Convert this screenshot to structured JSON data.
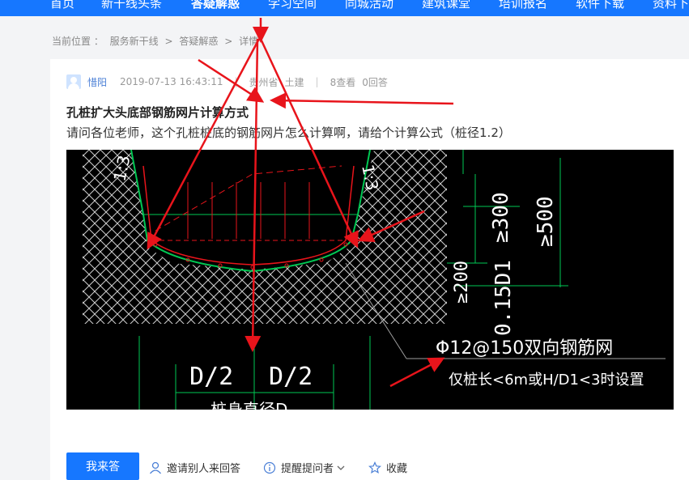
{
  "nav": {
    "items": [
      {
        "label": "首页"
      },
      {
        "label": "新干线头条"
      },
      {
        "label": "答疑解惑"
      },
      {
        "label": "学习空间"
      },
      {
        "label": "同城活动"
      },
      {
        "label": "建筑课堂"
      },
      {
        "label": "培训报名"
      },
      {
        "label": "软件下载"
      },
      {
        "label": "资料下"
      }
    ],
    "active": "答疑解惑"
  },
  "breadcrumb": {
    "prefix": "当前位置 ：",
    "items": [
      "服务新干线",
      "答疑解惑",
      "详情"
    ],
    "separator": ">"
  },
  "question": {
    "author": "惜阳",
    "datetime": "2019-07-13 16:43:11",
    "region": "贵州省",
    "category": "土建",
    "views": "8查看",
    "answers": "0回答",
    "title": "孔桩扩大头底部钢筋网片计算方式",
    "body": "请问各位老师，这个孔桩桩底的钢筋网片怎么计算啊，请给个计算公式（桩径1.2）"
  },
  "drawing": {
    "labels": {
      "slope_left": "1:3",
      "slope_right": "1:3",
      "dim_300": "≥300",
      "dim_500": "≥500",
      "dim_200": "≥200",
      "dim_015": "0.15D1",
      "half_left": "D/2",
      "half_right": "D/2",
      "rebar_note": "Φ12@150双向钢筋网",
      "rebar_cond": "仅桩长<6m或H/D1<3时设置",
      "bottom_partial": "桩身直径D"
    }
  },
  "actions": {
    "answer_label": "我来答",
    "invite_label": "邀请别人来回答",
    "remind_label": "提醒提问者",
    "favorite_label": "收藏"
  },
  "colors": {
    "brand": "#1677ff",
    "annotation_red": "#e8141b",
    "cad_green": "#00c853"
  }
}
